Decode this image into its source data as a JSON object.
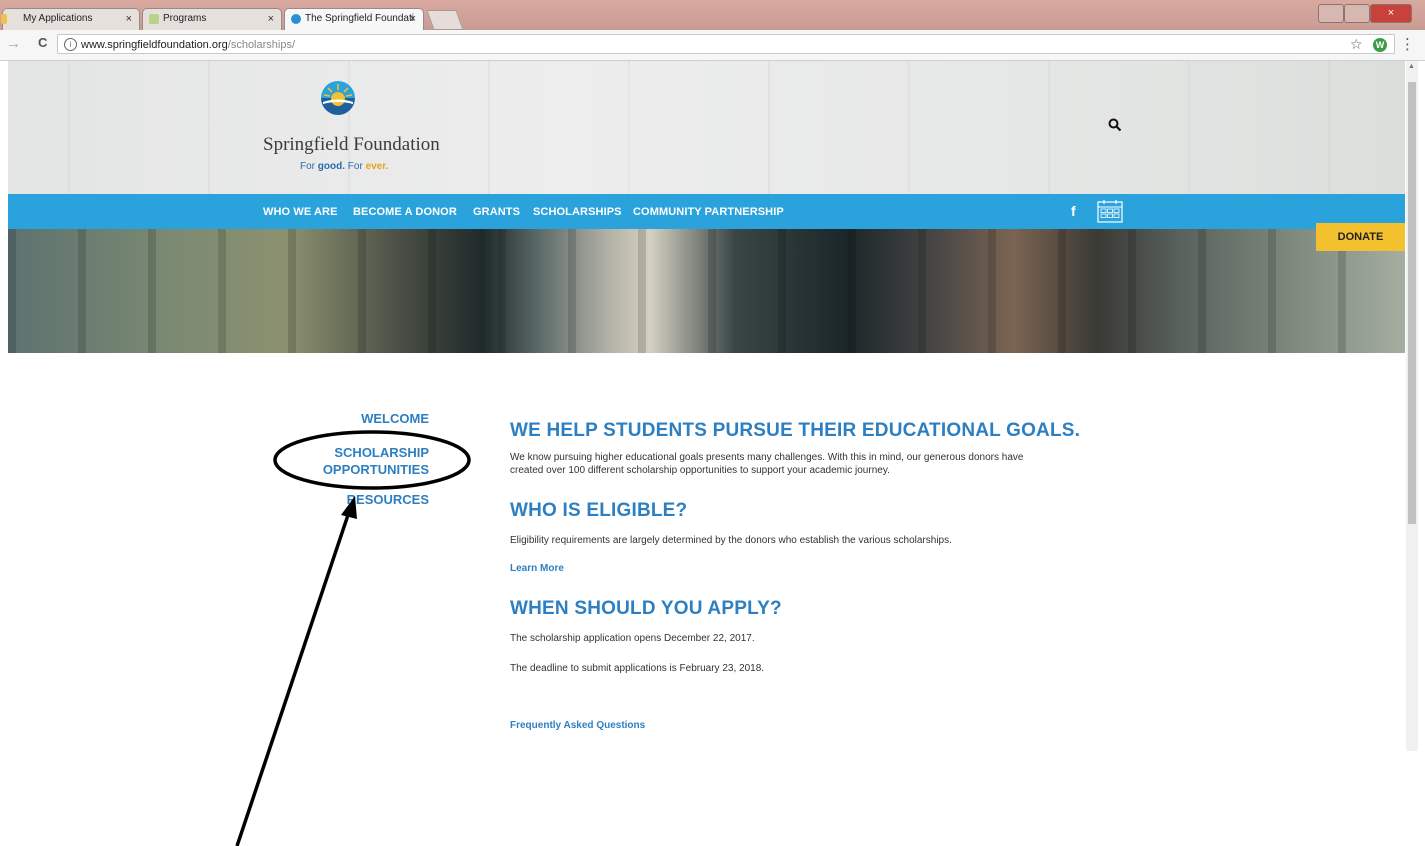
{
  "browser": {
    "tabs": [
      {
        "label": "My Applications",
        "close": "×"
      },
      {
        "label": "Programs",
        "close": "×"
      },
      {
        "label": "The Springfield Foundati",
        "close": "×"
      }
    ],
    "url_domain": "www.springfieldfoundation.org",
    "url_path": "/scholarships/",
    "star": "☆",
    "extension": "W",
    "menu": "⋮",
    "back": "→",
    "reload": "C",
    "info": "i"
  },
  "site": {
    "logo_name": "Springfield Foundation",
    "tagline_pre": "For ",
    "tagline_good": "good.",
    "tagline_mid": " For ",
    "tagline_ever": "ever.",
    "nav": [
      "WHO WE ARE",
      "BECOME A DONOR",
      "GRANTS",
      "SCHOLARSHIPS",
      "COMMUNITY PARTNERSHIP"
    ],
    "facebook": "f",
    "donate": "DONATE"
  },
  "sidebar": {
    "welcome": "WELCOME",
    "scholarship_line1": "SCHOLARSHIP",
    "scholarship_line2": "OPPORTUNITIES",
    "resources": "RESOURCES"
  },
  "main": {
    "heading1": "WE HELP STUDENTS PURSUE THEIR EDUCATIONAL GOALS.",
    "para1_line1": "We know pursuing higher educational goals presents many challenges. With this in mind, our generous donors have",
    "para1_line2": "created over 100 different scholarship opportunities to support your academic journey.",
    "heading2": "WHO IS ELIGIBLE?",
    "para2": "Eligibility requirements are largely determined by the donors who establish the various scholarships.",
    "learn_more": "Learn More",
    "heading3": "WHEN SHOULD YOU APPLY?",
    "para3": "The scholarship application opens December 22, 2017.",
    "para4": "The deadline to submit applications is February 23, 2018.",
    "faq": "Frequently Asked Questions"
  },
  "colors": {
    "nav_blue": "#2aa3dc",
    "link_blue": "#2d7fc1",
    "donate_yellow": "#f4c12e"
  },
  "icons": [
    "search-icon",
    "facebook-icon",
    "calendar-icon",
    "star-icon",
    "info-icon",
    "sunrise-logo-icon"
  ]
}
